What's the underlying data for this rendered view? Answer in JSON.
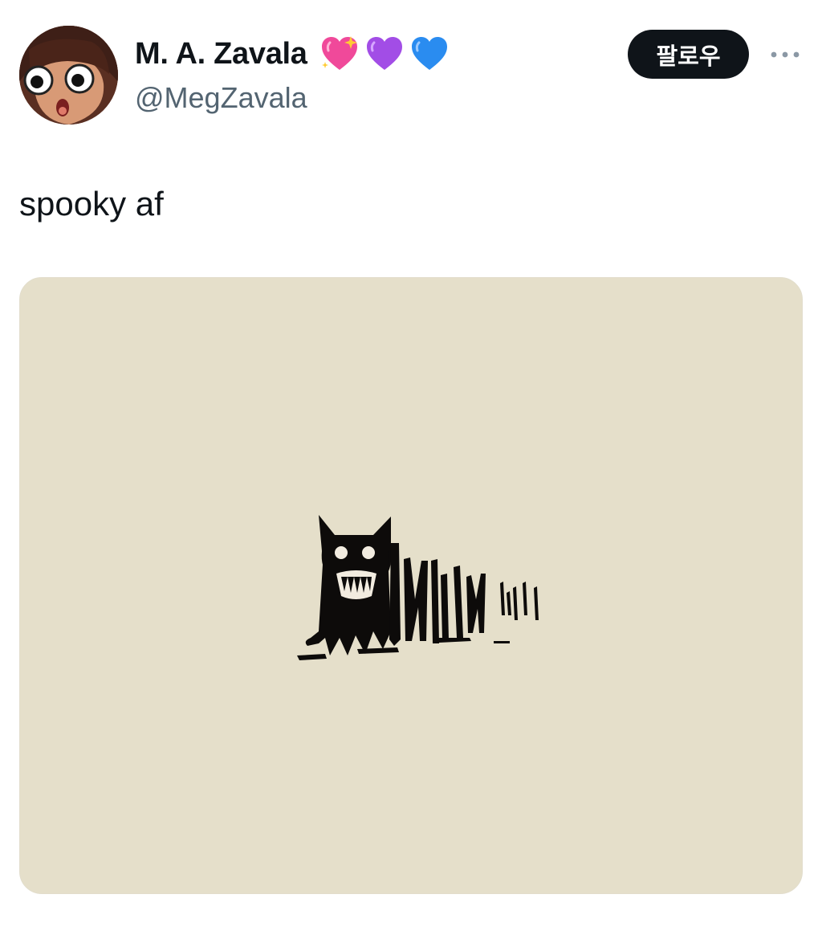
{
  "author": {
    "display_name": "M. A. Zavala",
    "handle": "@MegZavala",
    "name_emojis": [
      "sparkling-heart",
      "purple-heart",
      "blue-heart"
    ]
  },
  "actions": {
    "follow_label": "팔로우",
    "more_icon": "more-horizontal-icon"
  },
  "tweet": {
    "text": "spooky af"
  },
  "colors": {
    "text_primary": "#0f1419",
    "text_secondary": "#536471",
    "follow_bg": "#0f1419",
    "media_bg": "#e5dfca"
  }
}
